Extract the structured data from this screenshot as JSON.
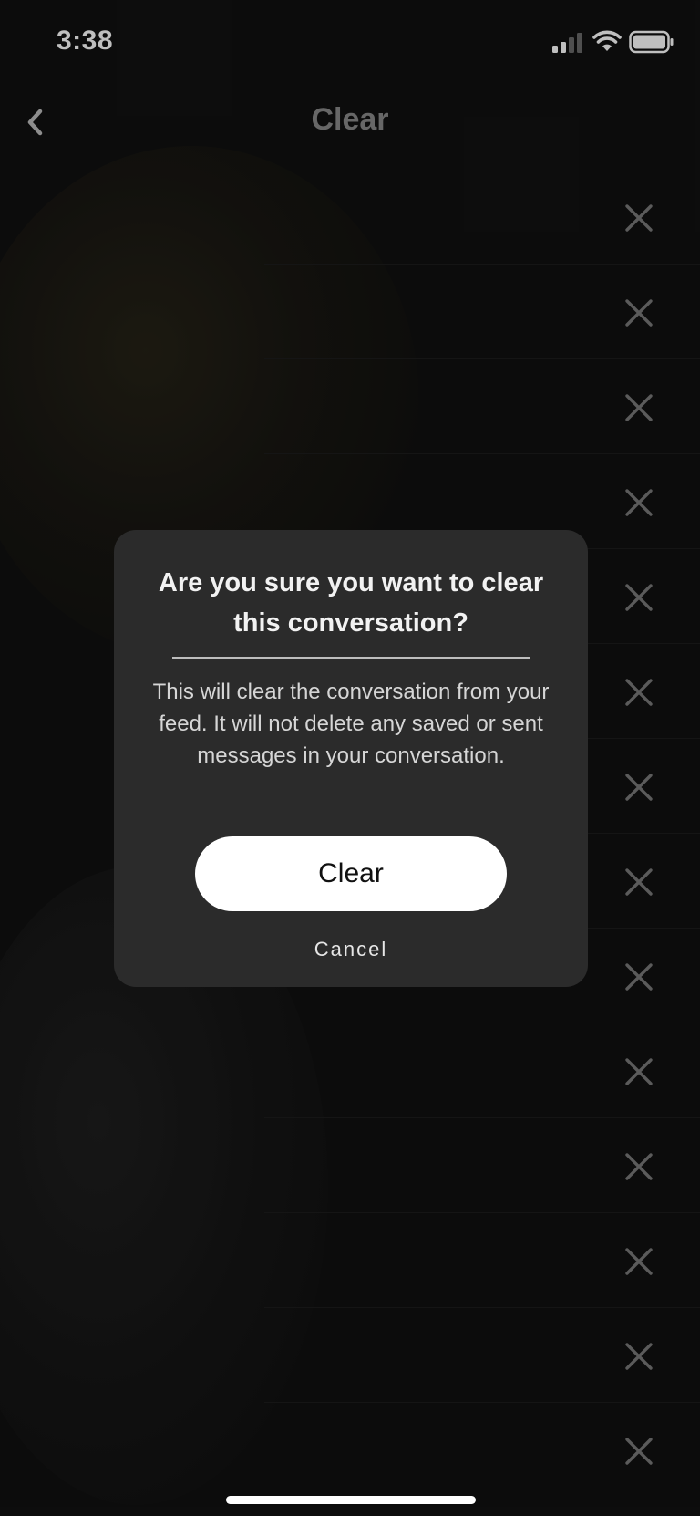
{
  "status_bar": {
    "time": "3:38"
  },
  "nav": {
    "title": "Clear",
    "back_icon": "chevron-left-icon"
  },
  "list": {
    "row_count": 14,
    "row_action_icon": "close-icon"
  },
  "dialog": {
    "title": "Are you sure you want to clear this conversation?",
    "body": "This will clear the conversation from your feed. It will not delete any saved or sent messages in your conversation.",
    "confirm_label": "Clear",
    "cancel_label": "Cancel"
  }
}
